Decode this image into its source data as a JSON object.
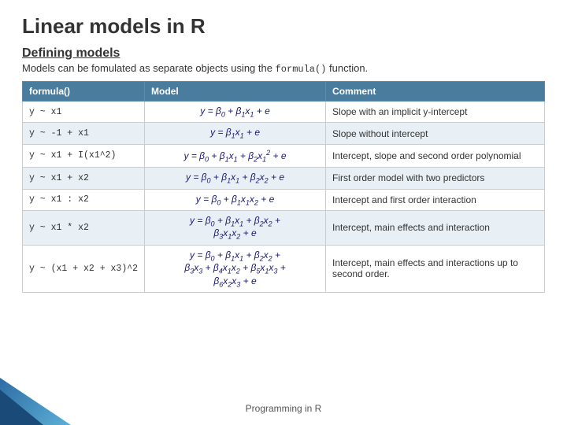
{
  "page": {
    "title": "Linear models in R",
    "section": "Defining models",
    "intro": "Models can be fomulated as separate objects using the formula() function.",
    "footer": "Programming in R"
  },
  "table": {
    "headers": [
      "formula()",
      "Model",
      "Comment"
    ],
    "rows": [
      {
        "formula": "y ~ x1",
        "model_html": "y = β₀ + β₁x₁ + e",
        "comment": "Slope with an implicit y-intercept"
      },
      {
        "formula": "y ~ -1 + x1",
        "model_html": "y = β₁x₁ + e",
        "comment": "Slope without intercept"
      },
      {
        "formula": "y ~ x1 + I(x1^2)",
        "model_html": "y = β₀ + β₁x₁ + β₂x₁² + e",
        "comment": "Intercept, slope and second order polynomial"
      },
      {
        "formula": "y ~ x1 + x2",
        "model_html": "y = β₀ + β₁x₁ + β₂x₂ + e",
        "comment": "First order model with two predictors"
      },
      {
        "formula": "y ~ x1 : x2",
        "model_html": "y = β₀ + β₁x₁x₂ + e",
        "comment": "Intercept and first order interaction"
      },
      {
        "formula": "y ~ x1 * x2",
        "model_html": "y = β₀ + β₁x₁ + β₂x₂ + β₃x₁x₂ + e",
        "comment": "Intercept, main effects and interaction"
      },
      {
        "formula": "y ~ (x1 + x2 + x3)^2",
        "model_html": "y = β₀ + β₁x₁ + β₂x₂ + β₃x₃ + β₄x₁x₂ + β₅x₁x₃ + β₆x₂x₃ + e",
        "comment": "Intercept, main effects and interactions up to second order."
      }
    ]
  }
}
